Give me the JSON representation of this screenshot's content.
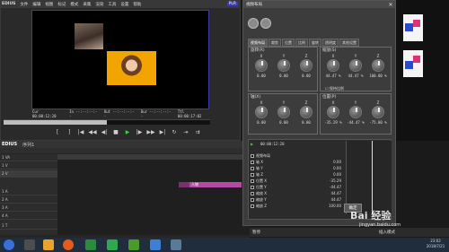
{
  "player": {
    "logo": "EDIUS",
    "menu": [
      "文件",
      "编辑",
      "视图",
      "标记",
      "模式",
      "采集",
      "渲染",
      "工具",
      "设置",
      "帮助"
    ],
    "mode_badge": "PLR",
    "timecodes": {
      "cur_label": "Cur",
      "cur": "00:00:12:20",
      "in_label": "In",
      "in": "--:--:--:--",
      "out_label": "Out",
      "out": "--:--:--:--",
      "dur_label": "Dur",
      "dur": "--:--:--:--",
      "ttl_label": "Ttl",
      "ttl": "00:00:17:02"
    },
    "scrub_progress": 0.5
  },
  "timeline": {
    "logo": "EDIUS",
    "sequence_tab": "序列1",
    "tracks": [
      "1 VA",
      "1 V",
      "2 V",
      "1 A",
      "2 A",
      "3 A",
      "4 A",
      "1 T"
    ],
    "clip_label": "人物"
  },
  "dialog": {
    "title": "视频布局",
    "tabs": [
      "视频布局",
      "裁剪",
      "位置",
      "比例",
      "旋转",
      "透明度",
      "其他设置"
    ],
    "groups": {
      "rotation_title": "旋转(R)",
      "rotation_knobs": [
        {
          "label": "X",
          "value": "0.00"
        },
        {
          "label": "Y",
          "value": "0.00"
        },
        {
          "label": "Z",
          "value": "0.00"
        }
      ],
      "scale_title": "缩放(S)",
      "scale_knobs": [
        {
          "label": "X",
          "value": "44.47 %"
        },
        {
          "label": "Y",
          "value": "44.47 %"
        },
        {
          "label": "Z",
          "value": "100.00 %"
        }
      ],
      "lock_ratio": "保持比例",
      "axis_title": "轴(X)",
      "axis_knobs": [
        {
          "label": "X",
          "value": "0.00"
        },
        {
          "label": "Y",
          "value": "0.00"
        },
        {
          "label": "Z",
          "value": "0.00"
        }
      ],
      "position_title": "位置(P)",
      "position_knobs": [
        {
          "label": "X",
          "value": "-35.29 %"
        },
        {
          "label": "Y",
          "value": "-44.47 %"
        },
        {
          "label": "Z",
          "value": "-75.00 %"
        }
      ]
    },
    "keyframe_rows": [
      {
        "label": "视频布局"
      },
      {
        "label": "轴 X",
        "value": "0.00"
      },
      {
        "label": "轴 Y",
        "value": "0.00"
      },
      {
        "label": "轴 Z",
        "value": "0.00"
      },
      {
        "label": "位置 X",
        "value": "-35.29"
      },
      {
        "label": "位置 Y",
        "value": "-44.47"
      },
      {
        "label": "缩放 X",
        "value": "44.47"
      },
      {
        "label": "缩放 Y",
        "value": "44.47"
      },
      {
        "label": "缩放 Z",
        "value": "100.00"
      }
    ],
    "kf_timecode": "00:00:12:20",
    "ok": "确定"
  },
  "status_bar": {
    "left": "暂停",
    "right": "插入模式"
  },
  "watermark": {
    "brand": "Bai 经验",
    "url": "jingyan.baidu.com"
  },
  "tray": {
    "time": "23:02",
    "date": "2018/7/21"
  },
  "colors": {
    "accent": "#3b3bb0",
    "play": "#3bd13b",
    "clip": "#b54aa6"
  }
}
